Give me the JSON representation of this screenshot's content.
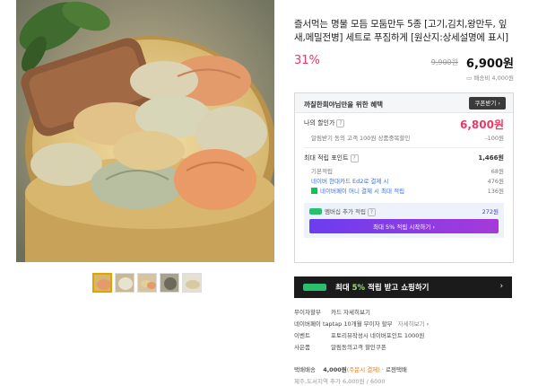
{
  "product": {
    "title": "즐서먹는 명물 모듬 모둠만두 5종 [고기,김치,왕만두, 잎새,메밀전병] 세트로 푸짐하게 [원산지:상세설명에 표시]",
    "discount": "31%",
    "original_price": "9,900원",
    "sale_price": "6,900원",
    "shipping_fee_top": "배송비 4,000원"
  },
  "benefits": {
    "header": "까칠한희야님만을 위한 혜택",
    "coupon_button": "쿠폰받기",
    "my_price_label": "나의 할인가",
    "my_price": "6,800원",
    "coupon_note": "알림받기 동의 고객 100원 상품중복할인",
    "coupon_note_value": "-100원",
    "max_points_label": "최대 적립 포인트",
    "max_points": "1,466원",
    "rows": [
      {
        "label": "기본적립",
        "value": "68원"
      },
      {
        "label": "네이버 현대카드 Ed2로 결제 시",
        "value": "476원"
      },
      {
        "label": "네이버페이 머니 결제 시 최대 적립",
        "value": "136원"
      }
    ],
    "membership_label": "멤버십 추가 적립",
    "membership_value": "272원",
    "membership_button": "최대 5% 적립 시작하기"
  },
  "big_button": {
    "text": "최대 5% 적립 받고 쇼핑하기",
    "pct": "5%",
    "prefix": "최대 ",
    "suffix": " 적립 받고 쇼핑하기"
  },
  "info_rows": [
    {
      "key": "무이자할부",
      "value": "카드 자세히보기"
    },
    {
      "key": "네이버페이 taptap 10개월 무이자 할부",
      "value": "",
      "link": "자세히보기"
    },
    {
      "key": "이벤트",
      "value": "포토리뷰작성시 네이버포인트 1000원"
    },
    {
      "key": "사은품",
      "value": "알림동의고객 할인쿠폰"
    }
  ],
  "shipping": {
    "label": "택배배송",
    "fee": "4,000원",
    "condition": "(주문시 결제)",
    "type": "로젠택배",
    "extra": "제주,도서지역 추가 6,000원 / 6000"
  },
  "colors": {
    "discount": "#e83a66",
    "membership_gradient_start": "#6b3df0",
    "membership_gradient_end": "#a63ad9",
    "naver_green": "#03c75a"
  }
}
